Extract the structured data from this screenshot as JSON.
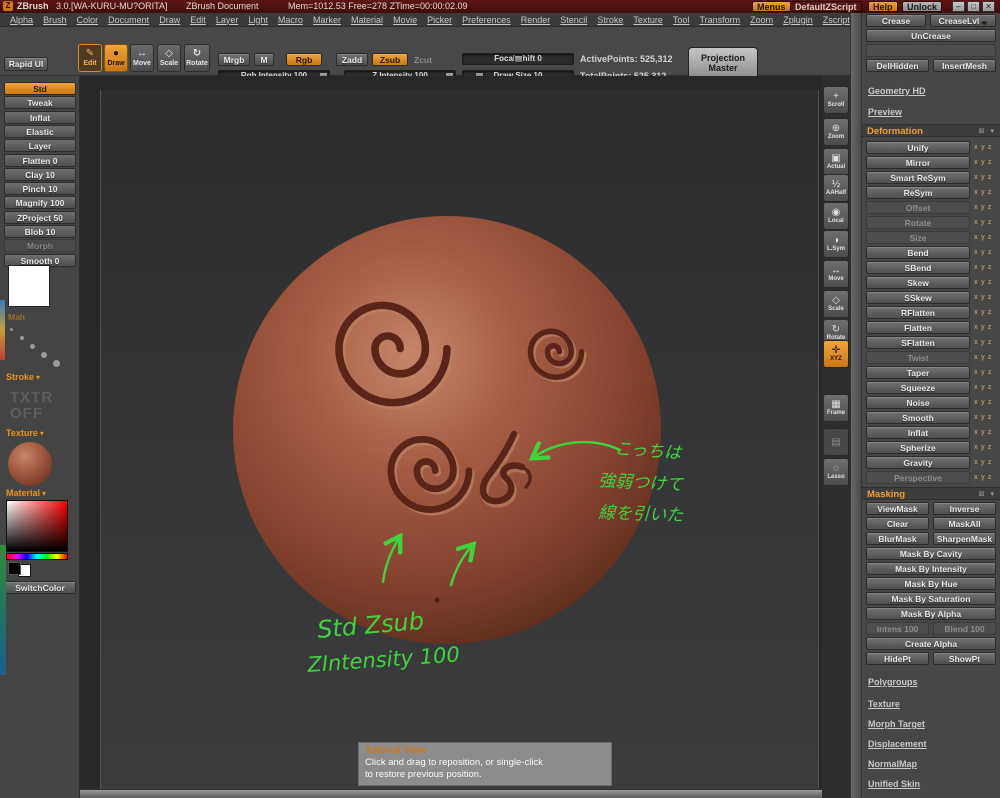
{
  "titlebar": {
    "app": "ZBrush",
    "version": "3.0.[WA-KURU-MU?ORITA]",
    "doc": "ZBrush Document",
    "stats": "Mem=1012.53  Free=278  ZTime=00:00:02.09",
    "menus_btn": "Menus",
    "defaultzscript_btn": "DefaultZScript",
    "help_btn": "Help",
    "unlock_btn": "Unlock"
  },
  "menubar": {
    "items": [
      "Alpha",
      "Brush",
      "Color",
      "Document",
      "Draw",
      "Edit",
      "Layer",
      "Light",
      "Macro",
      "Marker",
      "Material",
      "Movie",
      "Picker",
      "Preferences",
      "Render",
      "Stencil",
      "Stroke",
      "Texture",
      "Tool",
      "Transform",
      "Zoom",
      "Zplugin",
      "Zscript"
    ]
  },
  "shelf": {
    "rapid_ui": "Rapid UI",
    "edit": "Edit",
    "draw": "Draw",
    "move": "Move",
    "scale": "Scale",
    "rotate": "Rotate",
    "mrgb": "Mrgb",
    "m": "M",
    "rgb": "Rgb",
    "zadd": "Zadd",
    "zsub": "Zsub",
    "zcut": "Zcut",
    "rgb_intensity": "Rgb Intensity 100",
    "z_intensity": "Z Intensity 100",
    "focal_shift": "Focal Shift 0",
    "draw_size": "Draw Size 10",
    "active_points": "ActivePoints: 525,312",
    "total_points": "TotalPoints: 525,312",
    "projection_master": "Projection Master"
  },
  "left_tray": {
    "brushes": [
      {
        "label": "Std",
        "active": true
      },
      {
        "label": "Tweak"
      },
      {
        "label": "Inflat"
      },
      {
        "label": "Elastic"
      },
      {
        "label": "Layer"
      },
      {
        "label": "Flatten 0"
      },
      {
        "label": "Clay 10"
      },
      {
        "label": "Pinch 10"
      },
      {
        "label": "Magnify 100"
      },
      {
        "label": "ZProject 50"
      },
      {
        "label": "Blob 10"
      },
      {
        "label": "Morph",
        "dimmed": true
      },
      {
        "label": "Smooth 0"
      }
    ],
    "alpha_caption": "Mah",
    "stroke_label": "Stroke",
    "txtr_line1": "TXTR",
    "txtr_line2": "OFF",
    "texture_label": "Texture",
    "material_label": "Material",
    "switch_color": "SwitchColor"
  },
  "viewport": {
    "annotations": {
      "jp1": "こっちは",
      "jp2": "強弱つけて",
      "jp3": "線を引いた",
      "note1": "Std Zsub",
      "note2": "ZIntensity 100"
    },
    "tooltip": {
      "title": "Tutorial View",
      "line1": "Click and drag to reposition, or single-click",
      "line2": "to restore previous position."
    }
  },
  "right_toolbar": {
    "items": [
      {
        "name": "scroll",
        "glyph": "+",
        "label": "Scroll"
      },
      {
        "name": "zoom",
        "glyph": "⊕",
        "label": "Zoom"
      },
      {
        "name": "actual",
        "glyph": "▣",
        "label": "Actual"
      },
      {
        "name": "aahalf",
        "glyph": "½",
        "label": "AAHalf"
      },
      {
        "name": "local",
        "glyph": "◉",
        "label": "Local"
      },
      {
        "name": "lsym",
        "glyph": "◑",
        "label": "L.Sym"
      },
      {
        "name": "move",
        "glyph": "↔",
        "label": "Move"
      },
      {
        "name": "scale",
        "glyph": "◇",
        "label": "Scale"
      },
      {
        "name": "rotate",
        "glyph": "↻",
        "label": "Rotate"
      },
      {
        "name": "xyz",
        "glyph": "✛",
        "label": "XYZ",
        "active": true
      },
      {
        "name": "frame",
        "glyph": "▦",
        "label": "Frame"
      },
      {
        "name": "dimmed-tool",
        "glyph": "▤",
        "label": "",
        "dimmed": true
      },
      {
        "name": "lasso",
        "glyph": "◌",
        "label": "Lasso"
      }
    ]
  },
  "right_panel": {
    "crease": "Crease",
    "crease_lvl": "CreaseLvl",
    "uncrease": "UnCrease",
    "del_hidden": "DelHidden",
    "insert_mesh": "InsertMesh",
    "top_links": [
      "Geometry HD",
      "Preview"
    ],
    "deformation": {
      "title": "Deformation",
      "axes": [
        "x",
        "y",
        "z"
      ],
      "items": [
        {
          "label": "Unify"
        },
        {
          "label": "Mirror"
        },
        {
          "label": "Smart ReSym"
        },
        {
          "label": "ReSym"
        },
        {
          "label": "Offset",
          "dimmed": true
        },
        {
          "label": "Rotate",
          "dimmed": true
        },
        {
          "label": "Size",
          "dimmed": true
        },
        {
          "label": "Bend"
        },
        {
          "label": "SBend"
        },
        {
          "label": "Skew"
        },
        {
          "label": "SSkew"
        },
        {
          "label": "RFlatten"
        },
        {
          "label": "Flatten"
        },
        {
          "label": "SFlatten"
        },
        {
          "label": "Twist",
          "dimmed": true
        },
        {
          "label": "Taper"
        },
        {
          "label": "Squeeze"
        },
        {
          "label": "Noise"
        },
        {
          "label": "Smooth"
        },
        {
          "label": "Inflat"
        },
        {
          "label": "Spherize"
        },
        {
          "label": "Gravity"
        },
        {
          "label": "Perspective",
          "dimmed": true
        }
      ]
    },
    "masking": {
      "title": "Masking",
      "rows": [
        {
          "a": "ViewMask",
          "b": "Inverse"
        },
        {
          "a": "Clear",
          "b": "MaskAll"
        },
        {
          "a": "BlurMask",
          "b": "SharpenMask"
        },
        {
          "a": "Mask By Cavity"
        },
        {
          "a": "Mask By Intensity"
        },
        {
          "a": "Mask By Hue"
        },
        {
          "a": "Mask By Saturation"
        },
        {
          "a": "Mask By Alpha"
        },
        {
          "a": "Intens 100",
          "b": "Blend 100",
          "dimmed": true
        },
        {
          "a": "Create Alpha"
        },
        {
          "a": "HidePt",
          "b": "ShowPt"
        }
      ]
    },
    "bottom_links": [
      "Polygroups",
      "Texture",
      "Morph Target",
      "Displacement",
      "NormalMap",
      "Unified Skin"
    ]
  },
  "colors": {
    "accent_orange": "#e8931c",
    "annotation_green": "#3ed43e",
    "sphere_base": "#9a523c",
    "titlebar_red": "#5c1414"
  }
}
